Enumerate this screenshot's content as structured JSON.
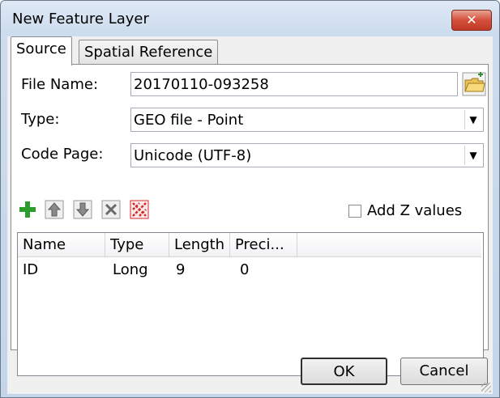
{
  "window": {
    "title": "New Feature Layer",
    "close_glyph": "✕"
  },
  "tabs": [
    {
      "label": "Source"
    },
    {
      "label": "Spatial Reference"
    }
  ],
  "form": {
    "file_name_label": "File Name:",
    "file_name_value": "20170110-093258",
    "type_label": "Type:",
    "type_value": "GEO file - Point",
    "code_page_label": "Code Page:",
    "code_page_value": "Unicode (UTF-8)",
    "add_z_label": "Add Z values",
    "add_z_checked": false
  },
  "toolbar_icons": [
    "add-field-icon",
    "move-up-icon",
    "move-down-icon",
    "delete-field-icon",
    "clear-all-icon"
  ],
  "grid": {
    "columns": [
      "Name",
      "Type",
      "Length",
      "Preci..."
    ],
    "rows": [
      [
        "ID",
        "Long",
        "9",
        "0"
      ]
    ]
  },
  "buttons": {
    "ok": "OK",
    "cancel": "Cancel"
  },
  "colors": {
    "title_gradient": "#cddcee",
    "close_red": "#d34f3a",
    "add_green": "#2a9d2a",
    "clear_red": "#d22a2a"
  }
}
